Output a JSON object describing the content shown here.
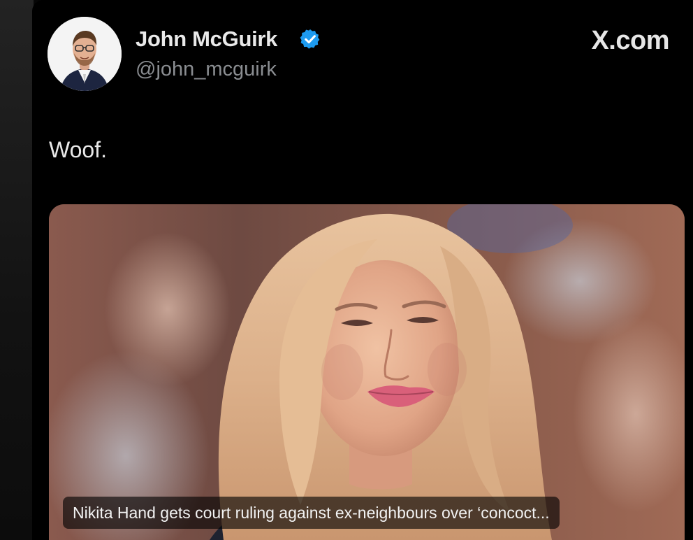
{
  "post": {
    "author_name": "John McGuirk",
    "author_handle": "@john_mcguirk",
    "site_label": "X.com",
    "text": "Woof.",
    "link_card": {
      "caption": "Nikita Hand gets court ruling against ex-neighbours over ‘concoct..."
    }
  },
  "icons": {
    "verified": "verified-badge-icon",
    "verified_color": "#1d9bf0"
  }
}
